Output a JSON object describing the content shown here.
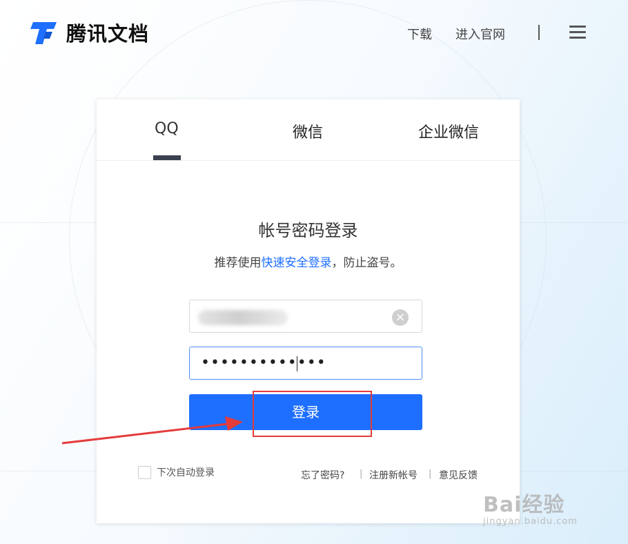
{
  "header": {
    "app_name": "腾讯文档",
    "nav": {
      "download": "下载",
      "official_site": "进入官网"
    },
    "logo_icon": "tencent-docs-logo-icon",
    "menu_icon": "hamburger-menu-icon"
  },
  "login": {
    "tabs": [
      {
        "label": "QQ",
        "active": true
      },
      {
        "label": "微信",
        "active": false
      },
      {
        "label": "企业微信",
        "active": false
      }
    ],
    "title": "帐号密码登录",
    "subtitle_prefix": "推荐使用",
    "subtitle_link": "快速安全登录",
    "subtitle_suffix": "，防止盗号。",
    "password_masked": "•••••••••••••",
    "login_button": "登录",
    "remember_me": "下次自动登录",
    "forgot_password": "忘了密码?",
    "register": "注册新帐号",
    "feedback": "意见反馈",
    "separator": "|"
  },
  "watermark": {
    "brand": "Bai经验",
    "url": "jingyan.baidu.com"
  },
  "colors": {
    "accent": "#1e6fff",
    "annotation": "#e43b3b",
    "tab_indicator": "#3a4250"
  }
}
